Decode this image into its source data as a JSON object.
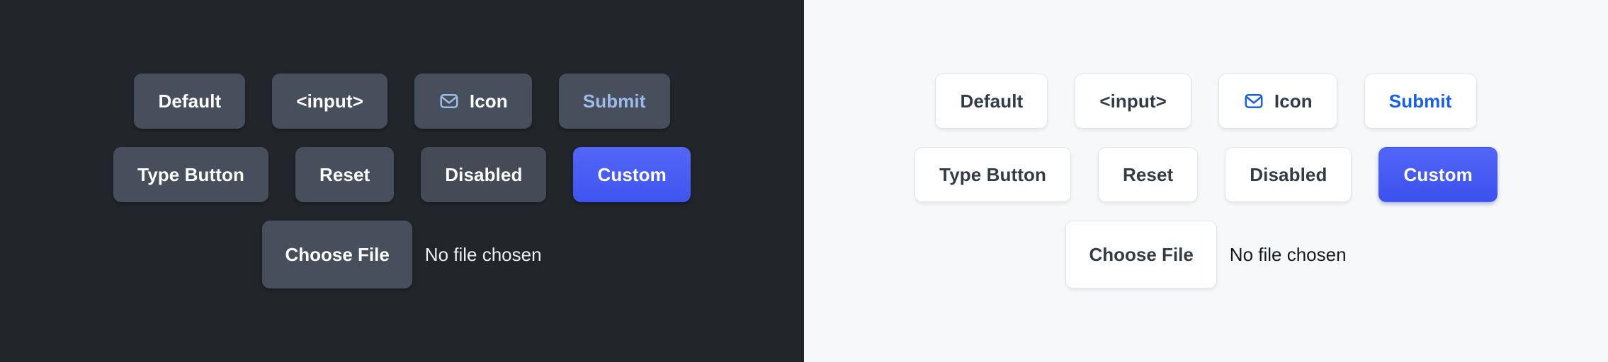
{
  "panels": [
    {
      "theme": "dark",
      "background": "#22262b",
      "rows": [
        {
          "buttons": [
            {
              "label": "Default",
              "variant": "default"
            },
            {
              "label": "<input>",
              "variant": "default"
            },
            {
              "label": "Icon",
              "variant": "default",
              "icon": "envelope-icon"
            },
            {
              "label": "Submit",
              "variant": "submit"
            }
          ]
        },
        {
          "buttons": [
            {
              "label": "Type Button",
              "variant": "default"
            },
            {
              "label": "Reset",
              "variant": "default"
            },
            {
              "label": "Disabled",
              "variant": "disabled"
            },
            {
              "label": "Custom",
              "variant": "custom"
            }
          ]
        }
      ],
      "file": {
        "button_label": "Choose File",
        "status_text": "No file chosen"
      },
      "colors": {
        "button_bg": "#474f5c",
        "button_text": "#ffffff",
        "submit_text": "#9dbbe8",
        "custom_bg": "#4a5cf5",
        "icon_stroke": "#9dbbe8"
      }
    },
    {
      "theme": "light",
      "background": "#f7f8fa",
      "rows": [
        {
          "buttons": [
            {
              "label": "Default",
              "variant": "default"
            },
            {
              "label": "<input>",
              "variant": "default"
            },
            {
              "label": "Icon",
              "variant": "default",
              "icon": "envelope-icon"
            },
            {
              "label": "Submit",
              "variant": "submit"
            }
          ]
        },
        {
          "buttons": [
            {
              "label": "Type Button",
              "variant": "default"
            },
            {
              "label": "Reset",
              "variant": "default"
            },
            {
              "label": "Disabled",
              "variant": "disabled"
            },
            {
              "label": "Custom",
              "variant": "custom"
            }
          ]
        }
      ],
      "file": {
        "button_label": "Choose File",
        "status_text": "No file chosen"
      },
      "colors": {
        "button_bg": "#ffffff",
        "button_text": "#323b48",
        "button_border": "#e2e5ea",
        "submit_text": "#1660e3",
        "custom_bg": "#4a5cf5",
        "icon_stroke": "#1660e3"
      }
    }
  ]
}
